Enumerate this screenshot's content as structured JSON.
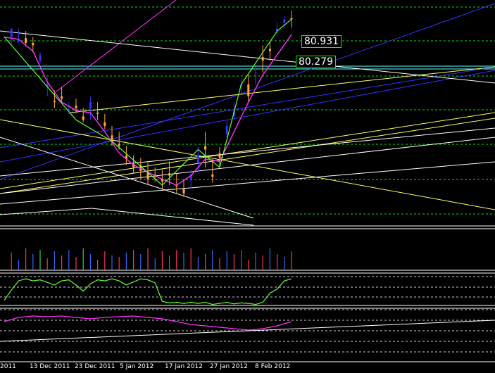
{
  "chart_data": {
    "type": "candlestick",
    "x_labels": [
      "2011",
      "13 Dec 2011",
      "23 Dec 2011",
      "5 Jan 2012",
      "17 Jan 2012",
      "27 Jan 2012",
      "8 Feb 2012"
    ],
    "price_labels": [
      "80.931",
      "80.279"
    ],
    "colors": {
      "background": "#000000",
      "bull_candle": "#3333ff",
      "bear_candle": "#ffaa33",
      "ma_line": "#ff33ff",
      "zigzag": "#66ff33",
      "grid": "#00ff00",
      "trend_blue": "#3333ff",
      "trend_white": "#ffffff",
      "trend_yellow": "#ffff66",
      "level_cyan": "#66ffff"
    },
    "price_panel": {
      "candles": [
        [
          1,
          150,
          143,
          150,
          157
        ],
        [
          2,
          152,
          157,
          145,
          152
        ],
        [
          3,
          149,
          155,
          142,
          145
        ],
        [
          4,
          145,
          150,
          137,
          143
        ],
        [
          5,
          130,
          137,
          128,
          135
        ],
        [
          6,
          108,
          116,
          100,
          110
        ],
        [
          7,
          96,
          105,
          90,
          95
        ],
        [
          8,
          100,
          108,
          95,
          98
        ],
        [
          9,
          88,
          95,
          85,
          88
        ],
        [
          10,
          92,
          98,
          86,
          90
        ],
        [
          11,
          83,
          90,
          78,
          80
        ],
        [
          12,
          90,
          100,
          80,
          95
        ],
        [
          13,
          86,
          95,
          80,
          85
        ],
        [
          14,
          78,
          85,
          72,
          75
        ],
        [
          15,
          67,
          75,
          58,
          62
        ],
        [
          16,
          60,
          70,
          55,
          58
        ],
        [
          17,
          50,
          58,
          42,
          47
        ],
        [
          18,
          43,
          50,
          35,
          40
        ],
        [
          19,
          42,
          48,
          30,
          37
        ],
        [
          20,
          36,
          45,
          25,
          30
        ],
        [
          21,
          34,
          40,
          28,
          32
        ],
        [
          22,
          30,
          38,
          22,
          28
        ],
        [
          23,
          35,
          45,
          25,
          33
        ],
        [
          24,
          25,
          35,
          18,
          24
        ],
        [
          25,
          22,
          30,
          15,
          18
        ],
        [
          26,
          29,
          38,
          22,
          34
        ],
        [
          27,
          44,
          58,
          36,
          50
        ],
        [
          28,
          58,
          70,
          40,
          55
        ],
        [
          29,
          34,
          47,
          27,
          32
        ],
        [
          30,
          52,
          57,
          40,
          48
        ],
        [
          31,
          68,
          80,
          65,
          75
        ],
        [
          32,
          83,
          95,
          80,
          88
        ],
        [
          33,
          108,
          115,
          103,
          110
        ],
        [
          34,
          110,
          118,
          95,
          100
        ],
        [
          35,
          118,
          125,
          110,
          118
        ],
        [
          36,
          133,
          143,
          120,
          130
        ],
        [
          37,
          140,
          146,
          130,
          138
        ],
        [
          38,
          155,
          162,
          150,
          157
        ],
        [
          39,
          162,
          168,
          158,
          165
        ],
        [
          40,
          166,
          172,
          158,
          165
        ]
      ],
      "ma_points": [
        [
          0,
          150
        ],
        [
          2,
          148
        ],
        [
          4,
          138
        ],
        [
          6,
          112
        ],
        [
          8,
          95
        ],
        [
          10,
          88
        ],
        [
          12,
          86
        ],
        [
          14,
          70
        ],
        [
          16,
          52
        ],
        [
          18,
          42
        ],
        [
          20,
          36
        ],
        [
          22,
          30
        ],
        [
          24,
          25
        ],
        [
          26,
          33
        ],
        [
          28,
          47
        ],
        [
          30,
          45
        ],
        [
          32,
          70
        ],
        [
          34,
          95
        ],
        [
          36,
          118
        ],
        [
          38,
          135
        ],
        [
          40,
          152
        ]
      ],
      "zigzag_points": [
        [
          0,
          150
        ],
        [
          10,
          80
        ],
        [
          15,
          62
        ],
        [
          22,
          25
        ],
        [
          27,
          55
        ],
        [
          30,
          40
        ],
        [
          33,
          110
        ],
        [
          38,
          155
        ],
        [
          40,
          165
        ]
      ]
    },
    "volume_panel": {
      "bars": [
        [
          1,
          24,
          "red"
        ],
        [
          2,
          14,
          "blue"
        ],
        [
          3,
          30,
          "red"
        ],
        [
          4,
          22,
          "blue"
        ],
        [
          5,
          28,
          "green"
        ],
        [
          6,
          16,
          "red"
        ],
        [
          7,
          26,
          "blue"
        ],
        [
          8,
          20,
          "red"
        ],
        [
          9,
          28,
          "blue"
        ],
        [
          10,
          18,
          "red"
        ],
        [
          11,
          30,
          "green"
        ],
        [
          12,
          22,
          "blue"
        ],
        [
          13,
          14,
          "red"
        ],
        [
          14,
          26,
          "red"
        ],
        [
          15,
          20,
          "blue"
        ],
        [
          16,
          18,
          "red"
        ],
        [
          17,
          24,
          "blue"
        ],
        [
          18,
          28,
          "red"
        ],
        [
          19,
          22,
          "blue"
        ],
        [
          20,
          30,
          "red"
        ],
        [
          21,
          16,
          "blue"
        ],
        [
          22,
          26,
          "red"
        ],
        [
          23,
          20,
          "blue"
        ],
        [
          24,
          28,
          "red"
        ],
        [
          25,
          24,
          "blue"
        ],
        [
          26,
          30,
          "red"
        ],
        [
          27,
          18,
          "blue"
        ],
        [
          28,
          22,
          "red"
        ],
        [
          29,
          28,
          "blue"
        ],
        [
          30,
          16,
          "red"
        ],
        [
          31,
          26,
          "blue"
        ],
        [
          32,
          22,
          "red"
        ],
        [
          33,
          28,
          "blue"
        ],
        [
          34,
          14,
          "red"
        ],
        [
          35,
          24,
          "blue"
        ],
        [
          36,
          20,
          "red"
        ],
        [
          37,
          30,
          "blue"
        ],
        [
          38,
          22,
          "red"
        ],
        [
          39,
          18,
          "blue"
        ],
        [
          40,
          26,
          "red"
        ]
      ]
    },
    "oscillator_panel": {
      "points": [
        [
          0,
          10
        ],
        [
          1,
          30
        ],
        [
          2,
          48
        ],
        [
          3,
          52
        ],
        [
          4,
          48
        ],
        [
          5,
          50
        ],
        [
          6,
          45
        ],
        [
          7,
          40
        ],
        [
          8,
          48
        ],
        [
          9,
          50
        ],
        [
          10,
          40
        ],
        [
          11,
          28
        ],
        [
          12,
          42
        ],
        [
          13,
          50
        ],
        [
          14,
          48
        ],
        [
          15,
          52
        ],
        [
          16,
          48
        ],
        [
          17,
          40
        ],
        [
          18,
          46
        ],
        [
          19,
          52
        ],
        [
          20,
          50
        ],
        [
          21,
          44
        ],
        [
          22,
          8
        ],
        [
          23,
          5
        ],
        [
          24,
          6
        ],
        [
          25,
          4
        ],
        [
          26,
          6
        ],
        [
          27,
          4
        ],
        [
          28,
          6
        ],
        [
          29,
          2
        ],
        [
          30,
          4
        ],
        [
          31,
          6
        ],
        [
          32,
          3
        ],
        [
          33,
          5
        ],
        [
          34,
          4
        ],
        [
          35,
          2
        ],
        [
          36,
          6
        ],
        [
          37,
          24
        ],
        [
          38,
          32
        ],
        [
          39,
          48
        ],
        [
          40,
          52
        ]
      ]
    },
    "rsi_panel": {
      "points": [
        [
          0,
          18
        ],
        [
          2,
          24
        ],
        [
          4,
          26
        ],
        [
          6,
          25
        ],
        [
          8,
          26
        ],
        [
          10,
          24
        ],
        [
          12,
          22
        ],
        [
          14,
          24
        ],
        [
          16,
          25
        ],
        [
          18,
          26
        ],
        [
          20,
          24
        ],
        [
          22,
          22
        ],
        [
          24,
          18
        ],
        [
          26,
          14
        ],
        [
          28,
          12
        ],
        [
          30,
          10
        ],
        [
          32,
          8
        ],
        [
          34,
          6
        ],
        [
          36,
          8
        ],
        [
          38,
          12
        ],
        [
          40,
          18
        ]
      ]
    }
  }
}
